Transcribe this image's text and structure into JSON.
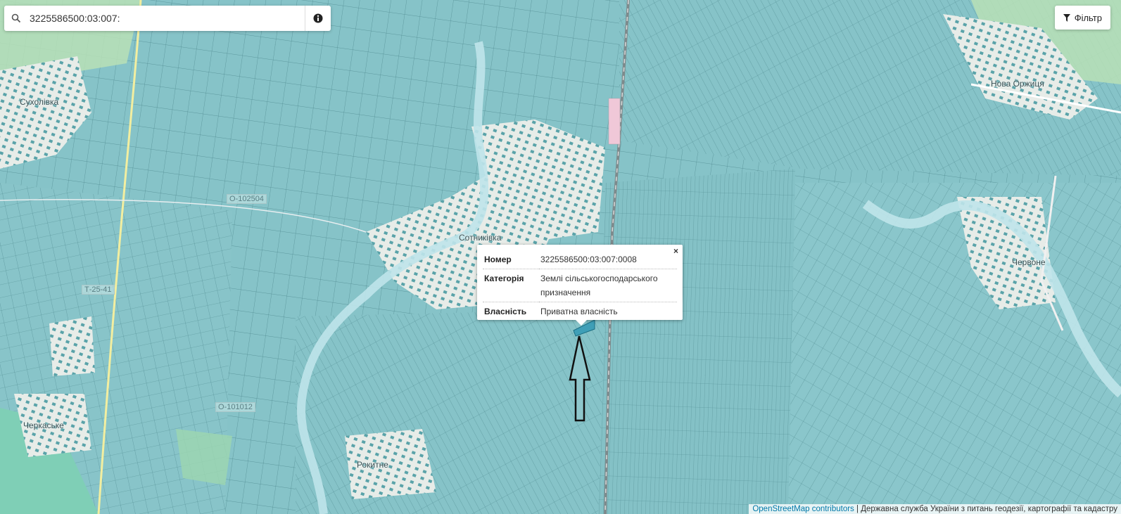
{
  "search": {
    "value": "3225586500:03:007:"
  },
  "filter": {
    "label": "Фільтр"
  },
  "popup": {
    "rows": [
      {
        "key": "Номер",
        "value": "3225586500:03:007:0008"
      },
      {
        "key": "Категорія",
        "value": "Землі сільськогосподарського призначення"
      },
      {
        "key": "Власність",
        "value": "Приватна власність"
      }
    ],
    "close": "×"
  },
  "map_labels": {
    "suholivka": "Сухолівка",
    "sotnykivka": "Сотниківка",
    "nova_orzhytsia": "Нова Оржиця",
    "chervone": "Червоне",
    "cherkaske": "Черкаське",
    "rokytne": "Рокитне"
  },
  "road_refs": {
    "o102504": "О-102504",
    "o101012": "О-101012",
    "t2541": "Т-25-41"
  },
  "attribution": {
    "osm": "OpenStreetMap contributors",
    "separator": " | ",
    "agency": "Державна служба України з питань геодезії, картографії та кадастру"
  },
  "colors": {
    "parcel_fill": "#86c3c8",
    "parcel_line": "#4f8a90",
    "settlement": "#e8ece8",
    "forest": "#b9e0b6",
    "river": "#bfe4ea"
  },
  "icons": {
    "search": "magnifier",
    "info": "info-circle",
    "filter": "funnel",
    "arrow": "up-arrow"
  }
}
